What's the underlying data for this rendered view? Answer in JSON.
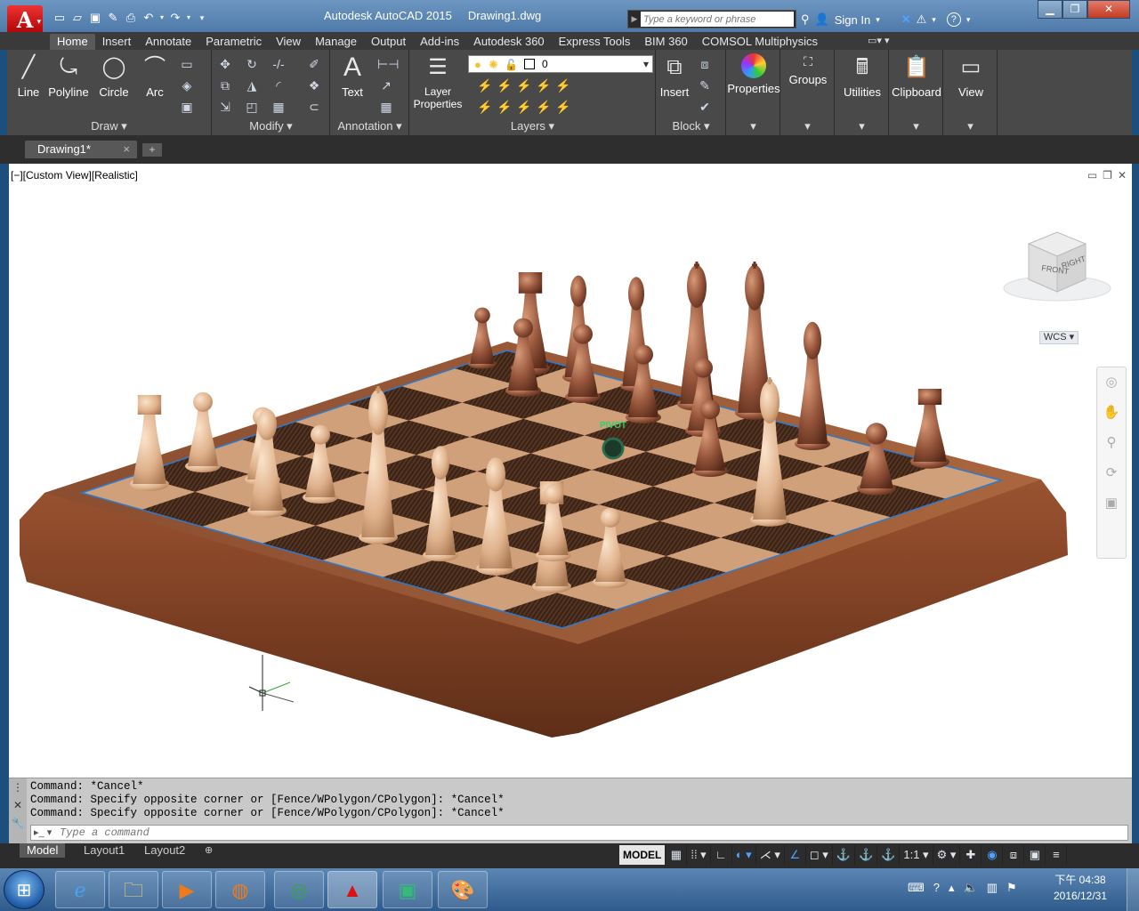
{
  "titlebar": {
    "title": "Autodesk AutoCAD 2015     Drawing1.dwg",
    "search_placeholder": "Type a keyword or phrase",
    "sign_in": "Sign In",
    "help": "?",
    "app_letter": "A"
  },
  "ribbon": {
    "tabs": [
      "Home",
      "Insert",
      "Annotate",
      "Parametric",
      "View",
      "Manage",
      "Output",
      "Add-ins",
      "Autodesk 360",
      "Express Tools",
      "BIM 360",
      "COMSOL Multiphysics"
    ],
    "active_tab": "Home",
    "draw": {
      "line": "Line",
      "polyline": "Polyline",
      "circle": "Circle",
      "arc": "Arc",
      "title": "Draw"
    },
    "modify": {
      "title": "Modify"
    },
    "annotation": {
      "text": "Text",
      "title": "Annotation"
    },
    "layers": {
      "layer_properties": "Layer\nProperties",
      "current_layer": "0",
      "title": "Layers"
    },
    "block": {
      "insert": "Insert",
      "title": "Block"
    },
    "properties": "Properties",
    "groups": "Groups",
    "utilities": "Utilities",
    "clipboard": "Clipboard",
    "view": "View"
  },
  "doc_tab": {
    "label": "Drawing1*",
    "close": "×",
    "new": "+"
  },
  "viewport": {
    "label": "[−][Custom View][Realistic]",
    "pivot_label": "PIVOT",
    "cube_front": "FRONT",
    "cube_right": "RIGHT",
    "wcs": "WCS"
  },
  "command": {
    "history": [
      "Command: *Cancel*",
      "Command: Specify opposite corner or [Fence/WPolygon/CPolygon]: *Cancel*",
      "Command: Specify opposite corner or [Fence/WPolygon/CPolygon]: *Cancel*"
    ],
    "placeholder": "Type a command"
  },
  "status": {
    "layout_tabs": [
      "Model",
      "Layout1",
      "Layout2"
    ],
    "model": "MODEL",
    "scale": "1:1"
  },
  "taskbar": {
    "clock_time": "下午 04:38",
    "clock_date": "2016/12/31"
  },
  "colors": {
    "accent": "#1d4f7e",
    "ribbon": "#494949",
    "board_frame": "#9a5a36",
    "light_square": "#cfa07a",
    "dark_square": "#3a2218",
    "light_piece": "#e3bb96",
    "dark_piece": "#8e4f33"
  }
}
